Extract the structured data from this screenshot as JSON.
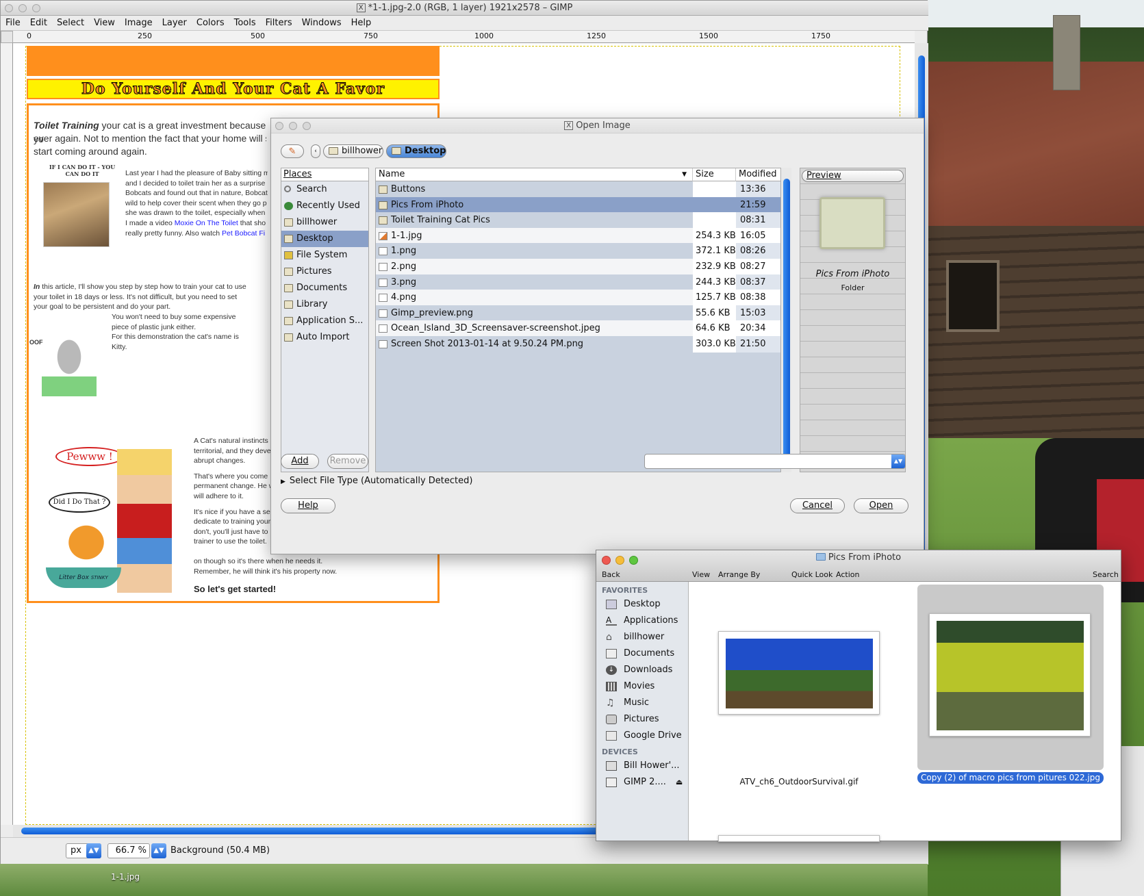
{
  "gimp": {
    "title": "*1-1.jpg-2.0 (RGB, 1 layer) 1921x2578 – GIMP",
    "menu": [
      "File",
      "Edit",
      "Select",
      "View",
      "Image",
      "Layer",
      "Colors",
      "Tools",
      "Filters",
      "Windows",
      "Help"
    ],
    "ruler_labels": [
      "0",
      "250",
      "500",
      "750",
      "1000",
      "1250",
      "1500",
      "1750"
    ],
    "status": {
      "unit": "px",
      "zoom": "66.7 %",
      "layer_info": "Background (50.4 MB)"
    },
    "taskbar_label": "1-1.jpg"
  },
  "webpage": {
    "banner": "Do Yourself And Your Cat A Favor",
    "intro_bold": "Toilet Training",
    "intro_rest": " your cat is a great investment because yo",
    "intro_line2": "ever again. Not to mention the fact that your home will sme",
    "intro_line3": "start coming around again.",
    "bobcat_caption": "If I Can Do It - You Can Do It",
    "para1": [
      "Last year I had the pleasure of Baby sitting m",
      "and I decided to toilet train her as a surprise",
      "Bobcats and found out that in nature, Bobcat",
      "wild to help cover their scent when they go p",
      "she was drawn to the toilet, especially when"
    ],
    "para1_line6_pre": "I made a video ",
    "para1_link1": "Moxie On The Toilet",
    "para1_line6_post": " that sho",
    "para1_line7_pre": "really pretty funny. Also watch ",
    "para1_link2": "Pet Bobcat Fi",
    "para2_bold": "In",
    "para2": [
      " this article, I'll show you step by step how to train your cat to use",
      "your toilet in 18 days or less. It's not difficult, but you need to set",
      "your goal to be persistent and do your part."
    ],
    "para3": [
      "You won't need to buy some expensive",
      "piece of plastic junk either.",
      "For this demonstration the cat's name is",
      "Kitty."
    ],
    "oof": "OOF",
    "para4": [
      "A Cat's natural instincts",
      "territorial, and they deve",
      "abrupt changes.",
      "",
      "That's where you come",
      "permanent change. He w",
      "will adhere to it.",
      "",
      "It's nice if you have a se",
      "dedicate to training your",
      "don't, you'll just have to",
      "trainer to use the toilet.",
      "on though so it's there when he needs it.",
      "Remember, he will think it's his property now."
    ],
    "pewww": "Pewww !",
    "did_i": "Did I Do That ?",
    "litter": "Litter Box",
    "stinky": "STINKY",
    "lets_start": "So let's get started!"
  },
  "open_dialog": {
    "title": "Open Image",
    "breadcrumbs": [
      "billhower",
      "Desktop"
    ],
    "places_header": "Places",
    "places": [
      "Search",
      "Recently Used",
      "billhower",
      "Desktop",
      "File System",
      "Pictures",
      "Documents",
      "Library",
      "Application S...",
      "Auto Import"
    ],
    "selected_place": "Desktop",
    "columns": [
      "Name",
      "Size",
      "Modified"
    ],
    "files": [
      {
        "name": "Buttons",
        "size": "",
        "modified": "13:36",
        "type": "folder"
      },
      {
        "name": "Pics From iPhoto",
        "size": "",
        "modified": "21:59",
        "type": "folder"
      },
      {
        "name": "Toilet Training Cat Pics",
        "size": "",
        "modified": "08:31",
        "type": "folder"
      },
      {
        "name": "1-1.jpg",
        "size": "254.3 KB",
        "modified": "16:05",
        "type": "image"
      },
      {
        "name": "1.png",
        "size": "372.1 KB",
        "modified": "08:26",
        "type": "file"
      },
      {
        "name": "2.png",
        "size": "232.9 KB",
        "modified": "08:27",
        "type": "file"
      },
      {
        "name": "3.png",
        "size": "244.3 KB",
        "modified": "08:37",
        "type": "file"
      },
      {
        "name": "4.png",
        "size": "125.7 KB",
        "modified": "08:38",
        "type": "file"
      },
      {
        "name": "Gimp_preview.png",
        "size": "55.6 KB",
        "modified": "15:03",
        "type": "file"
      },
      {
        "name": "Ocean_Island_3D_Screensaver-screenshot.jpeg",
        "size": "64.6 KB",
        "modified": "20:34",
        "type": "file"
      },
      {
        "name": "Screen Shot 2013-01-14 at 9.50.24 PM.png",
        "size": "303.0 KB",
        "modified": "21:50",
        "type": "file"
      }
    ],
    "selected_file": "Pics From iPhoto",
    "preview_label": "Preview",
    "preview_name": "Pics From iPhoto",
    "preview_kind": "Folder",
    "add": "Add",
    "remove": "Remove",
    "file_type": "Select File Type (Automatically Detected)",
    "help": "Help",
    "cancel": "Cancel",
    "open": "Open"
  },
  "finder": {
    "title": "Pics From iPhoto",
    "toolbar": {
      "back": "Back",
      "view": "View",
      "arrange": "Arrange By",
      "quicklook": "Quick Look",
      "action": "Action",
      "search": "Search"
    },
    "favorites_header": "FAVORITES",
    "favorites": [
      "Desktop",
      "Applications",
      "billhower",
      "Documents",
      "Downloads",
      "Movies",
      "Music",
      "Pictures",
      "Google Drive"
    ],
    "devices_header": "DEVICES",
    "devices": [
      "Bill Hower'...",
      "GIMP 2...."
    ],
    "items": [
      {
        "name": "ATV_ch6_OutdoorSurvival.gif"
      },
      {
        "name": "Copy (2) of macro pics from pitures 022.jpg"
      }
    ]
  }
}
